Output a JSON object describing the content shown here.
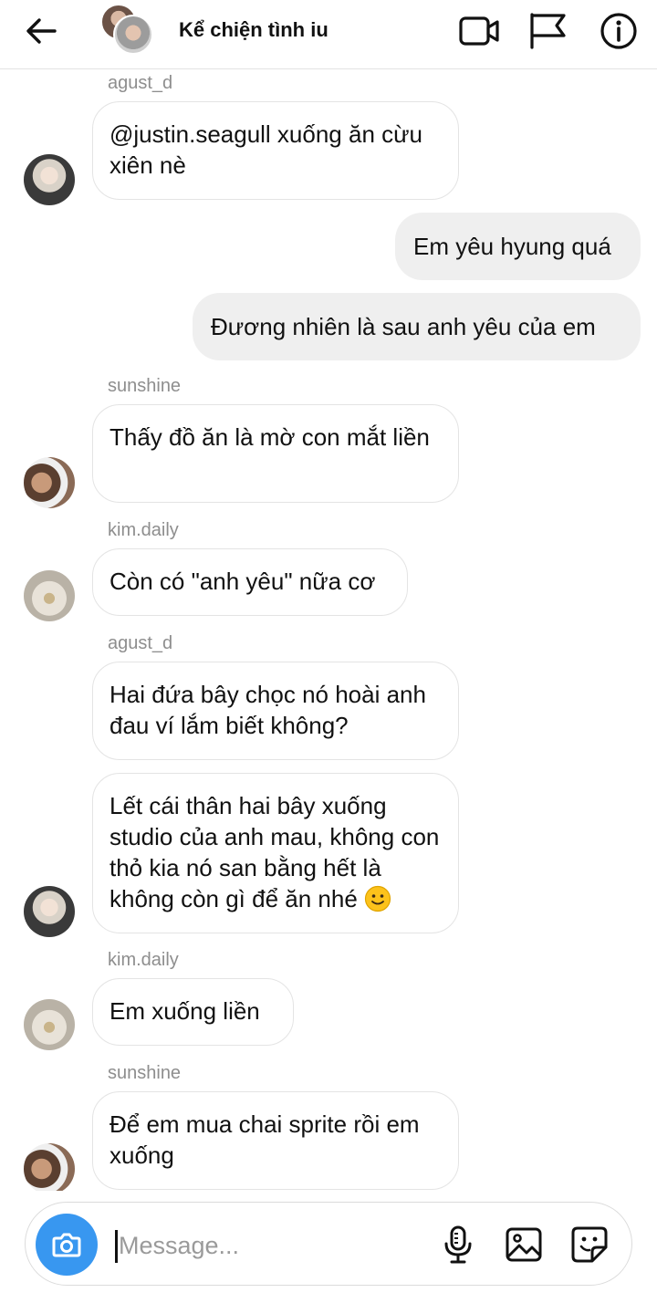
{
  "header": {
    "title": "Kể chiện tình iu",
    "icons": [
      "back-arrow-icon",
      "video-call-icon",
      "flag-icon",
      "info-icon"
    ]
  },
  "messages": [
    {
      "type": "in",
      "sender": "agust_d",
      "text": "@justin.seagull xuống ăn cừu xiên nè",
      "avatar": "agust_d"
    },
    {
      "type": "out",
      "text": "Em yêu hyung quá"
    },
    {
      "type": "out",
      "text": "Đương nhiên là sau anh yêu của em"
    },
    {
      "type": "in",
      "sender": "sunshine",
      "text": "Thấy đồ ăn là mờ con mắt liền",
      "avatar": "sunshine"
    },
    {
      "type": "in",
      "sender": "kim.daily",
      "text": "Còn có \"anh yêu\" nữa cơ",
      "avatar": "kim.daily"
    },
    {
      "type": "in",
      "sender": "agust_d",
      "text": "Hai đứa bây chọc nó hoài anh đau ví lắm biết không?"
    },
    {
      "type": "in",
      "text": "Lết cái thân hai bây xuống studio của anh mau, không con thỏ kia nó san bằng hết là không còn gì để ăn nhé",
      "emoji": "slightly-smiling-face",
      "avatar": "agust_d"
    },
    {
      "type": "in",
      "sender": "kim.daily",
      "text": "Em xuống liền",
      "avatar": "kim.daily"
    },
    {
      "type": "in",
      "sender": "sunshine",
      "text": "Để em mua chai sprite rồi em xuống",
      "avatar": "sunshine"
    }
  ],
  "composer": {
    "placeholder": "Message...",
    "value": "",
    "icons": [
      "camera-icon",
      "microphone-icon",
      "gallery-icon",
      "sticker-icon"
    ]
  },
  "colors": {
    "accent": "#3897f0",
    "outgoing_bubble": "#efefef",
    "sender_label": "#8e8e8e"
  }
}
